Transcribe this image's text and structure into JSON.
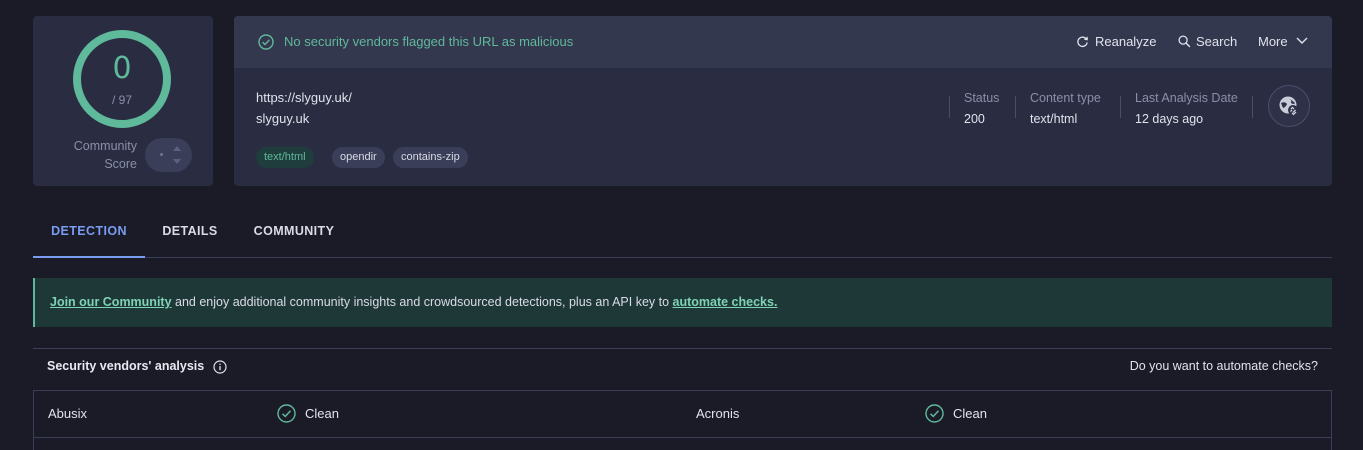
{
  "score": {
    "value": "0",
    "total": "/ 97",
    "community_label_1": "Community",
    "community_label_2": "Score"
  },
  "header": {
    "flag_text": "No security vendors flagged this URL as malicious",
    "actions": {
      "reanalyze": "Reanalyze",
      "search": "Search",
      "more": "More"
    }
  },
  "target": {
    "url": "https://slyguy.uk/",
    "domain": "slyguy.uk",
    "tags": [
      "text/html",
      "opendir",
      "contains-zip"
    ]
  },
  "meta": {
    "status_label": "Status",
    "status_value": "200",
    "content_type_label": "Content type",
    "content_type_value": "text/html",
    "last_analysis_label": "Last Analysis Date",
    "last_analysis_value": "12 days ago"
  },
  "tabs": [
    "DETECTION",
    "DETAILS",
    "COMMUNITY"
  ],
  "banner": {
    "link1": "Join our Community",
    "middle": " and enjoy additional community insights and crowdsourced detections, plus an API key to ",
    "link2": "automate checks."
  },
  "analysis": {
    "title": "Security vendors' analysis",
    "automate_question": "Do you want to automate checks?",
    "rows": [
      {
        "vendor_a": "Abusix",
        "verdict_a": "Clean",
        "vendor_b": "Acronis",
        "verdict_b": "Clean"
      }
    ]
  },
  "colors": {
    "accent_green": "#5fb99b",
    "accent_blue": "#7a9cf0",
    "background": "#1b1b27",
    "card": "#2a2d42"
  }
}
